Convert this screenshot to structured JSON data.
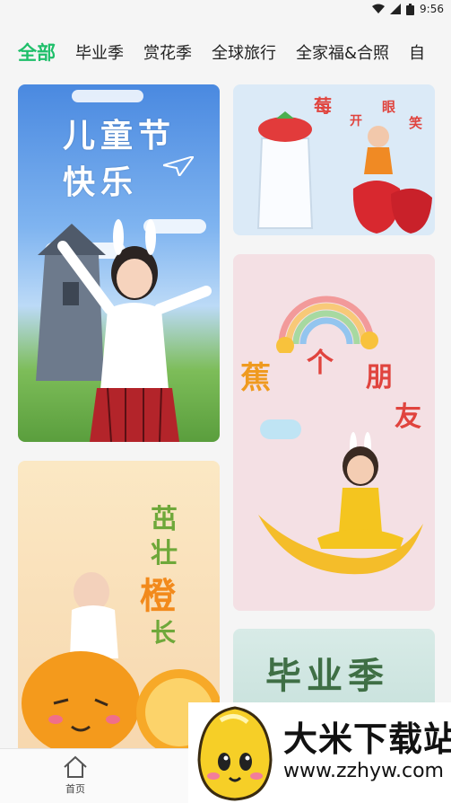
{
  "status_bar": {
    "time": "9:56"
  },
  "tabs": [
    {
      "label": "全部",
      "active": true
    },
    {
      "label": "毕业季",
      "active": false
    },
    {
      "label": "赏花季",
      "active": false
    },
    {
      "label": "全球旅行",
      "active": false
    },
    {
      "label": "全家福&合照",
      "active": false
    },
    {
      "label": "自",
      "active": false
    }
  ],
  "cards": {
    "childrens_day": {
      "line1": "儿童节",
      "line2": "快乐"
    },
    "strawberry": {
      "chars": [
        "莓",
        "开",
        "眼",
        "笑"
      ]
    },
    "banana": {
      "chars": [
        "蕉",
        "个",
        "朋",
        "友"
      ]
    },
    "orange": {
      "chars": [
        "茁",
        "壮",
        "橙",
        "长"
      ]
    },
    "graduation": {
      "title": "毕业季"
    }
  },
  "bottom_nav": {
    "home_label": "首页"
  },
  "watermark": {
    "name": "大米下载站",
    "url": "www.zzhyw.com"
  },
  "colors": {
    "accent": "#1fbf6a"
  }
}
